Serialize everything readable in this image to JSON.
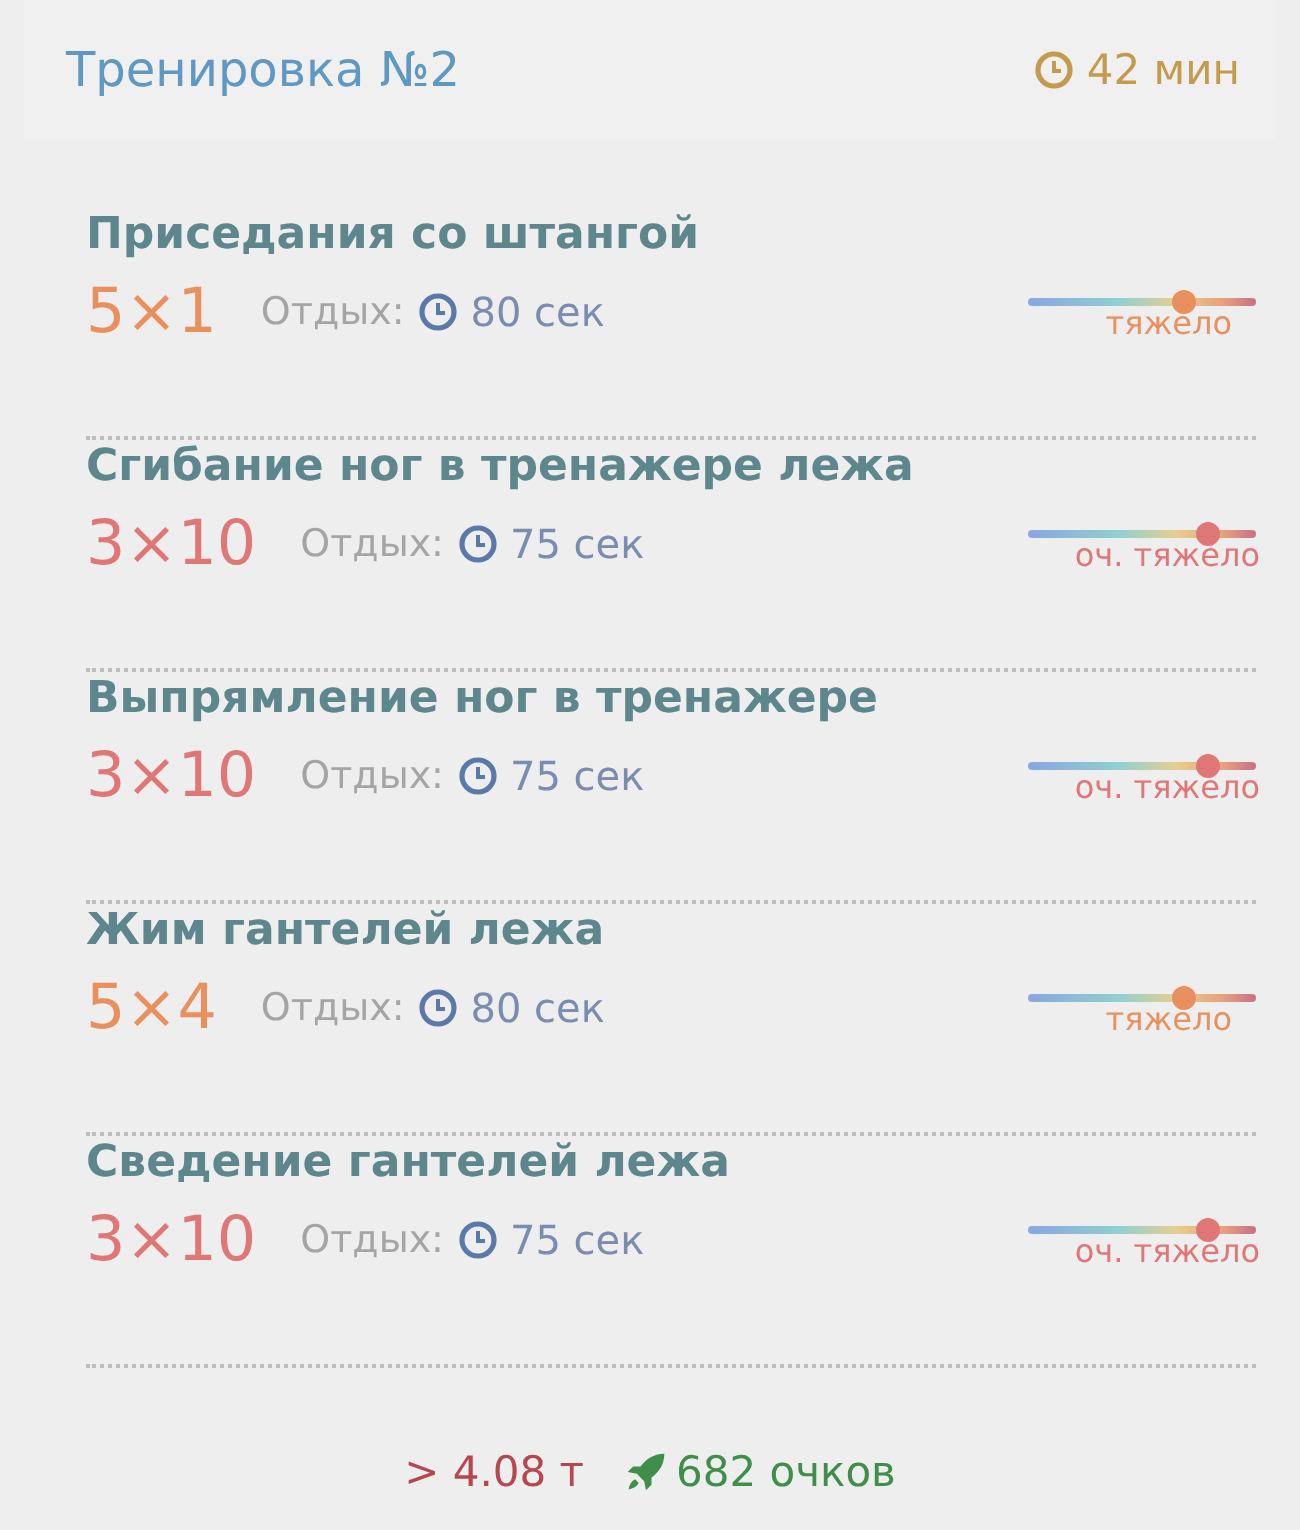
{
  "header": {
    "title": "Тренировка №2",
    "duration": "42 мин"
  },
  "exercises": [
    {
      "name": "Приседания со штангой",
      "sets": "5×1",
      "rest_label": "Отдых:",
      "rest": "80 сек",
      "kind": "heavy",
      "level": 0.68,
      "intensity": "тяжело"
    },
    {
      "name": "Сгибание ног в тренажере лежа",
      "sets": "3×10",
      "rest_label": "Отдых:",
      "rest": "75 сек",
      "kind": "very_heavy",
      "level": 0.79,
      "intensity": "оч. тяжело"
    },
    {
      "name": "Выпрямление ног в тренажере",
      "sets": "3×10",
      "rest_label": "Отдых:",
      "rest": "75 сек",
      "kind": "very_heavy",
      "level": 0.79,
      "intensity": "оч. тяжело"
    },
    {
      "name": "Жим гантелей лежа",
      "sets": "5×4",
      "rest_label": "Отдых:",
      "rest": "80 сек",
      "kind": "heavy",
      "level": 0.68,
      "intensity": "тяжело"
    },
    {
      "name": "Сведение гантелей лежа",
      "sets": "3×10",
      "rest_label": "Отдых:",
      "rest": "75 сек",
      "kind": "very_heavy",
      "level": 0.79,
      "intensity": "оч. тяжело"
    }
  ],
  "footer": {
    "tonnage": "> 4.08 т",
    "points": "682 очков"
  }
}
